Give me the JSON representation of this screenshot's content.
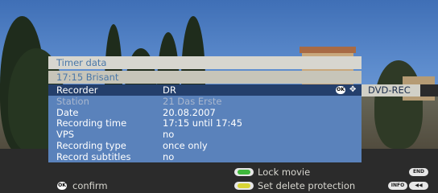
{
  "dialog": {
    "title": "Timer data",
    "subtitle": "17:15 Brisant",
    "rows": [
      {
        "label": "Recorder",
        "value": "DR"
      },
      {
        "label": "Station",
        "value": "21 Das Erste"
      },
      {
        "label": "Date",
        "value": "20.08.2007"
      },
      {
        "label": "Recording time",
        "value": "17:15 until 17:45"
      },
      {
        "label": "VPS",
        "value": "no"
      },
      {
        "label": "Recording type",
        "value": "once only"
      },
      {
        "label": "Record subtitles",
        "value": "no"
      }
    ],
    "side_option": "DVD-REC",
    "ok_badge": "OK",
    "nav_glyph": "✥"
  },
  "footer": {
    "confirm_label": "confirm",
    "confirm_badge": "OK",
    "lock_movie": "Lock movie",
    "set_delete_protection": "Set delete protection",
    "end_key": "END",
    "info_key": "INFO",
    "rewind_glyph": "◀◀"
  },
  "colors": {
    "green": "#3fb83b",
    "yellow": "#d8d435",
    "panel": "#5a82bb",
    "selected": "#243f6b"
  }
}
